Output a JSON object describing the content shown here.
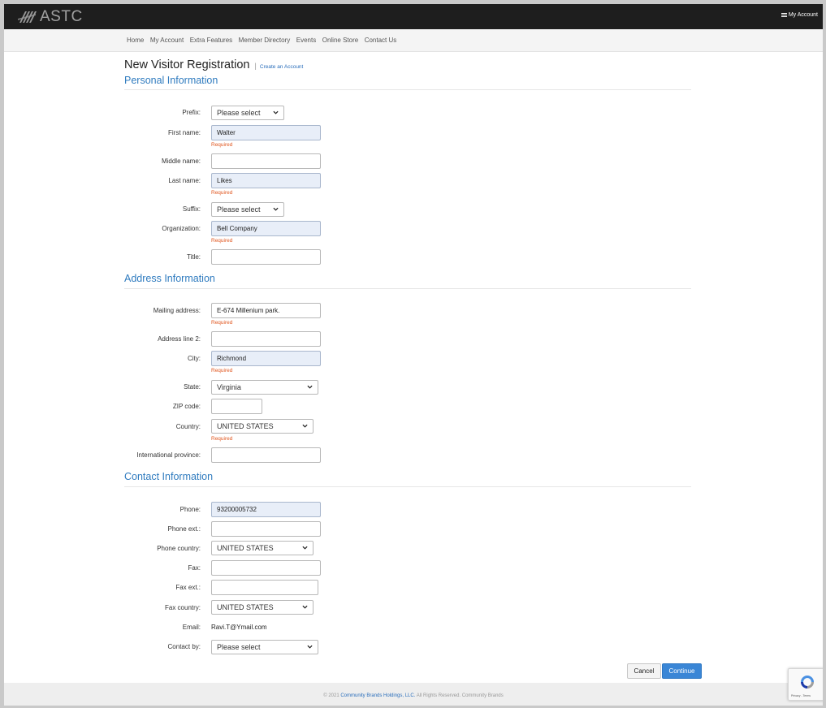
{
  "header": {
    "logo_text": "ASTC",
    "my_account": "My Account"
  },
  "nav": [
    "Home",
    "My Account",
    "Extra Features",
    "Member Directory",
    "Events",
    "Online Store",
    "Contact Us"
  ],
  "page": {
    "title": "New Visitor Registration",
    "separator": "|",
    "create_link": "Create an Account"
  },
  "personal": {
    "heading": "Personal Information",
    "prefix_label": "Prefix:",
    "prefix_value": "Please select",
    "first_name_label": "First name:",
    "first_name_value": "Walter",
    "middle_name_label": "Middle name:",
    "middle_name_value": "",
    "last_name_label": "Last name:",
    "last_name_value": "Likes",
    "suffix_label": "Suffix:",
    "suffix_value": "Please select",
    "organization_label": "Organization:",
    "organization_value": "Bell Company",
    "title_label": "Title:",
    "title_value": ""
  },
  "address": {
    "heading": "Address Information",
    "mailing_label": "Mailing address:",
    "mailing_value": "E-674 Millenium park.",
    "line2_label": "Address line 2:",
    "line2_value": "",
    "city_label": "City:",
    "city_value": "Richmond",
    "state_label": "State:",
    "state_value": "Virginia",
    "zip_label": "ZIP code:",
    "zip_value": "",
    "country_label": "Country:",
    "country_value": "UNITED STATES",
    "intl_label": "International province:",
    "intl_value": ""
  },
  "contact": {
    "heading": "Contact Information",
    "phone_label": "Phone:",
    "phone_value": "93200005732",
    "phone_ext_label": "Phone ext.:",
    "phone_ext_value": "",
    "phone_country_label": "Phone country:",
    "phone_country_value": "UNITED STATES",
    "fax_label": "Fax:",
    "fax_value": "",
    "fax_ext_label": "Fax ext.:",
    "fax_ext_value": "",
    "fax_country_label": "Fax country:",
    "fax_country_value": "UNITED STATES",
    "email_label": "Email:",
    "email_value": "Ravi.T@Ymail.com",
    "contact_by_label": "Contact by:",
    "contact_by_value": "Please select"
  },
  "required_text": "Required",
  "buttons": {
    "cancel": "Cancel",
    "continue": "Continue"
  },
  "footer": {
    "prefix": "© 2021 ",
    "brand": "Community Brands Holdings, LLC.",
    "suffix": " All Rights Reserved. Community Brands"
  },
  "recaptcha": {
    "privacy": "Privacy - Terms"
  },
  "colors": {
    "topbar": "#1e1e1e",
    "section_heading": "#2f7bbf",
    "required": "#e0561e",
    "filled_input": "#e8eef8",
    "continue_button": "#3a86d6"
  }
}
